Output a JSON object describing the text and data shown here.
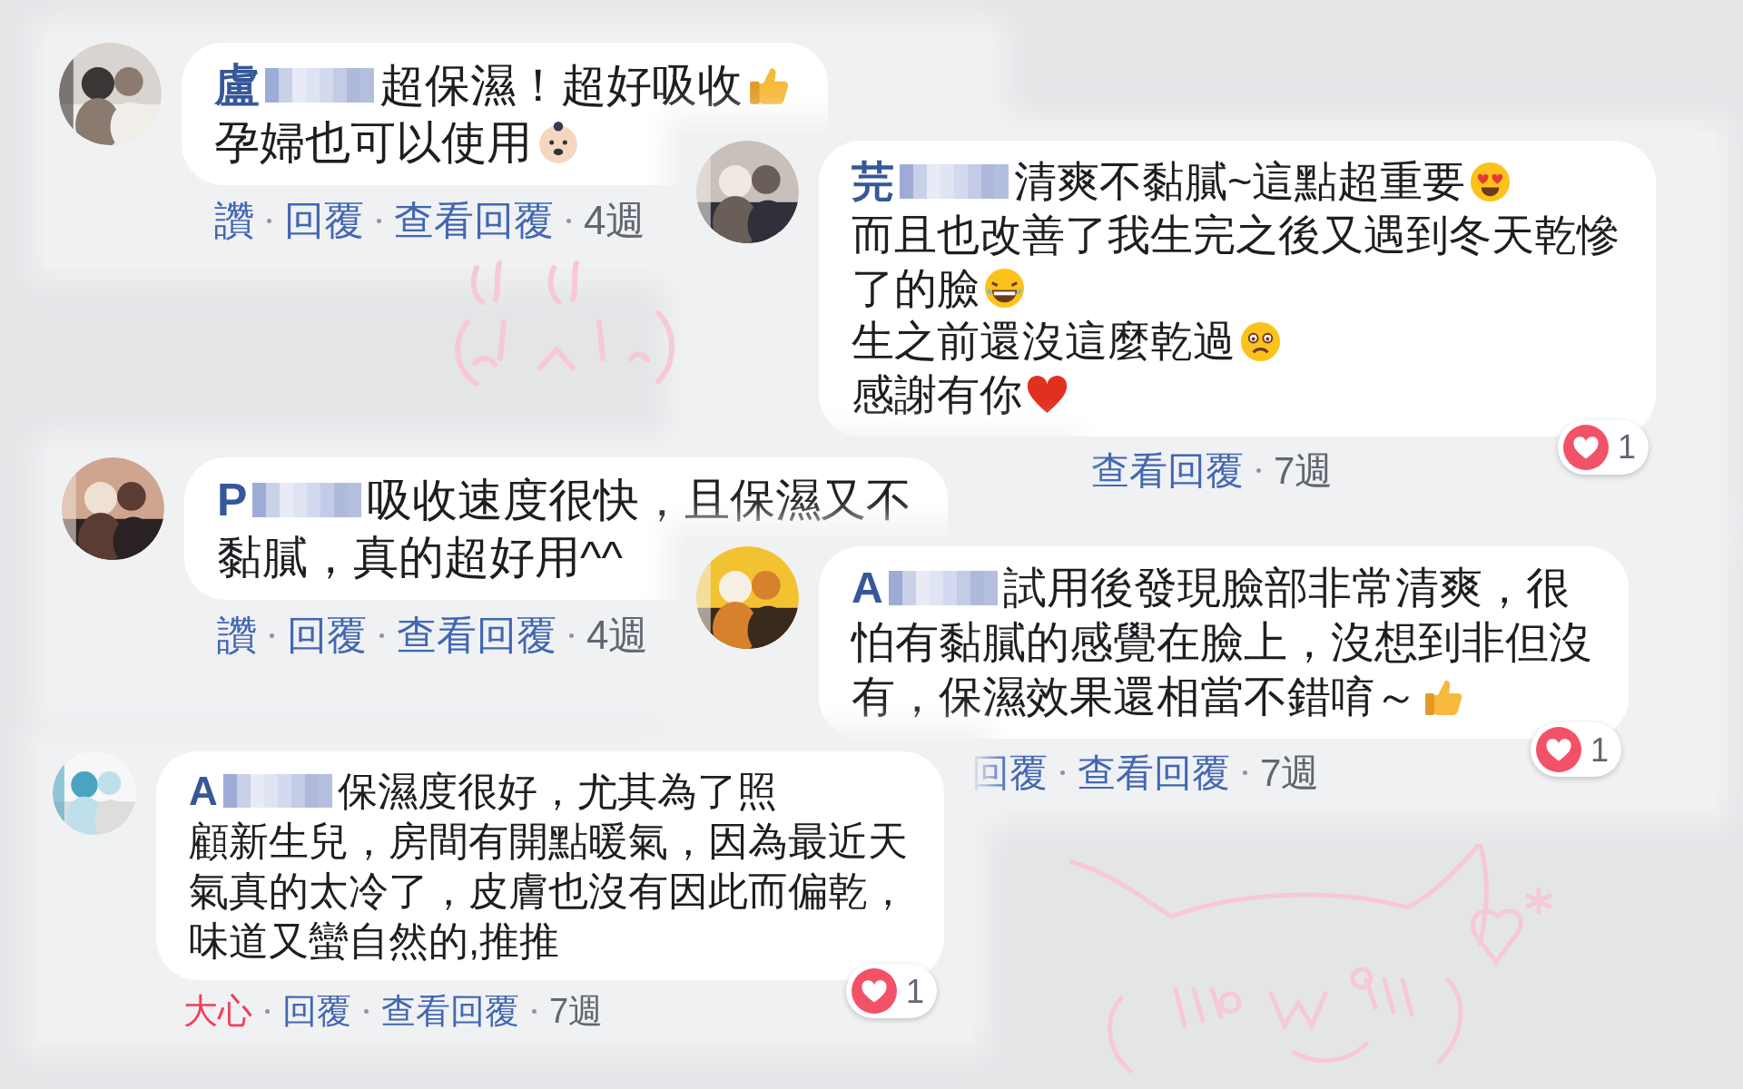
{
  "comments": [
    {
      "name": "盧",
      "lines": [
        {
          "text": "超保濕！超好吸收",
          "kind": "thumbs-up"
        },
        {
          "text": "孕婦也可以使用",
          "kind": "baby"
        }
      ],
      "actions": [
        {
          "label": "讚",
          "kind": "link"
        },
        {
          "label": "回覆",
          "kind": "link"
        },
        {
          "label": "查看回覆",
          "kind": "link"
        },
        {
          "label": "4週",
          "kind": "time"
        }
      ]
    },
    {
      "name": "芫",
      "lines": [
        {
          "text": "清爽不黏膩~這點超重要",
          "kind": "heart-eyes"
        },
        {
          "text": "而且也改善了我生完之後又遇到冬天乾慘",
          "kind": "plain"
        },
        {
          "text": "了的臉",
          "kind": "laughing"
        },
        {
          "text": "生之前還沒這麼乾過",
          "kind": "frown"
        },
        {
          "text": "感謝有你",
          "kind": "heart"
        }
      ],
      "reactions": "1",
      "actions": [
        {
          "label": "查看回覆",
          "kind": "link"
        },
        {
          "label": "7週",
          "kind": "time"
        }
      ]
    },
    {
      "name": "P",
      "lines": [
        {
          "text": "吸收速度很快，且保濕又不",
          "kind": "plain"
        },
        {
          "text": "黏膩，真的超好用^^",
          "kind": "plain"
        }
      ],
      "actions": [
        {
          "label": "讚",
          "kind": "link"
        },
        {
          "label": "回覆",
          "kind": "link"
        },
        {
          "label": "查看回覆",
          "kind": "link"
        },
        {
          "label": "4週",
          "kind": "time"
        }
      ]
    },
    {
      "name": "A",
      "lines": [
        {
          "text": "試用後發現臉部非常清爽，很",
          "kind": "plain"
        },
        {
          "text": "怕有黏膩的感覺在臉上，沒想到非但沒",
          "kind": "plain"
        },
        {
          "text": "有，保濕效果還相當不錯唷～",
          "kind": "thumbs-up"
        }
      ],
      "reactions": "1",
      "actions": [
        {
          "label": "回覆",
          "kind": "link"
        },
        {
          "label": "查看回覆",
          "kind": "link"
        },
        {
          "label": "7週",
          "kind": "time"
        }
      ]
    },
    {
      "name": "A",
      "lines": [
        {
          "text": "保濕度很好，尤其為了照",
          "kind": "plain"
        },
        {
          "text": "顧新生兒，房間有開點暖氣，因為最近天",
          "kind": "plain"
        },
        {
          "text": "氣真的太冷了，皮膚也沒有因此而偏乾，",
          "kind": "plain"
        },
        {
          "text": "味道又蠻自然的,推推",
          "kind": "plain"
        }
      ],
      "reactions": "1",
      "actions": [
        {
          "label": "大心",
          "kind": "reacted"
        },
        {
          "label": "回覆",
          "kind": "link"
        },
        {
          "label": "查看回覆",
          "kind": "link"
        },
        {
          "label": "7週",
          "kind": "time"
        }
      ]
    }
  ]
}
